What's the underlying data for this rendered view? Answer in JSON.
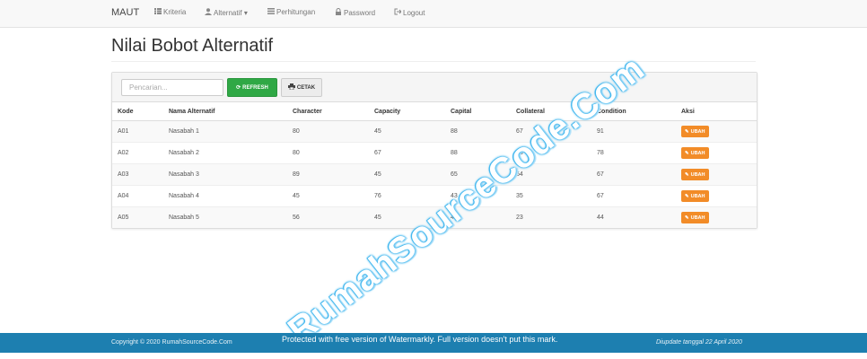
{
  "navbar": {
    "brand": "MAUT",
    "items": [
      {
        "label": "Kriteria",
        "icon": "th-icon"
      },
      {
        "label": "Alternatif",
        "icon": "user-icon"
      },
      {
        "label": "Perhitungan",
        "icon": "list-icon"
      },
      {
        "label": "Password",
        "icon": "lock-icon"
      },
      {
        "label": "Logout",
        "icon": "logout-icon"
      }
    ]
  },
  "page": {
    "title": "Nilai Bobot Alternatif"
  },
  "toolbar": {
    "search_placeholder": "Pencarian...",
    "refresh_label": "REFRESH",
    "print_label": "CETAK"
  },
  "table": {
    "headers": [
      "Kode",
      "Nama Alternatif",
      "Character",
      "Capacity",
      "Capital",
      "Collateral",
      "Condition",
      "Aksi"
    ],
    "rows": [
      {
        "kode": "A01",
        "nama": "Nasabah 1",
        "character": "80",
        "capacity": "45",
        "capital": "88",
        "collateral": "67",
        "condition": "91",
        "action": "UBAH"
      },
      {
        "kode": "A02",
        "nama": "Nasabah 2",
        "character": "80",
        "capacity": "67",
        "capital": "88",
        "collateral": "43",
        "condition": "78",
        "action": "UBAH"
      },
      {
        "kode": "A03",
        "nama": "Nasabah 3",
        "character": "89",
        "capacity": "45",
        "capital": "65",
        "collateral": "64",
        "condition": "67",
        "action": "UBAH"
      },
      {
        "kode": "A04",
        "nama": "Nasabah 4",
        "character": "45",
        "capacity": "76",
        "capital": "43",
        "collateral": "35",
        "condition": "67",
        "action": "UBAH"
      },
      {
        "kode": "A05",
        "nama": "Nasabah 5",
        "character": "56",
        "capacity": "45",
        "capital": "42",
        "collateral": "23",
        "condition": "44",
        "action": "UBAH"
      }
    ]
  },
  "footer": {
    "copyright": "Copyright © 2020 RumahSourceCode.Com",
    "updated": "Diupdate tanggal 22 April 2020",
    "watermark_notice": "Protected with free version of Watermarkly. Full version doesn't put this mark."
  },
  "watermark": {
    "text": "RumahSourceCode.Com"
  },
  "colors": {
    "footer": "#1d7fb0",
    "refresh": "#2fa845",
    "ubah": "#f28c28",
    "watermark_outline": "#47b9ef"
  }
}
